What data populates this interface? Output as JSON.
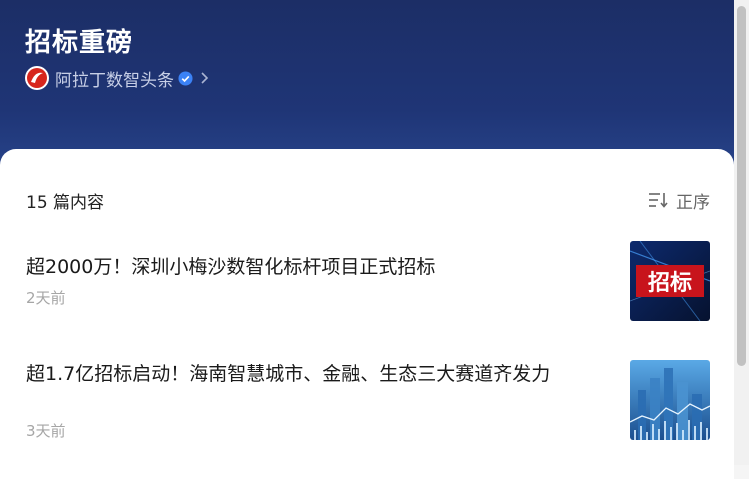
{
  "header": {
    "title": "招标重磅",
    "author": "阿拉丁数智头条"
  },
  "list": {
    "count_label": "15 篇内容",
    "sort_label": "正序"
  },
  "articles": [
    {
      "title": "超2000万！深圳小梅沙数智化标杆项目正式招标",
      "time": "2天前",
      "thumb_text": "招标"
    },
    {
      "title": "超1.7亿招标启动！海南智慧城市、金融、生态三大赛道齐发力",
      "time": "3天前"
    }
  ],
  "colors": {
    "header_bg": "#1f3576",
    "verified_badge": "#3b82f6",
    "thumb_red": "#c8141c"
  }
}
